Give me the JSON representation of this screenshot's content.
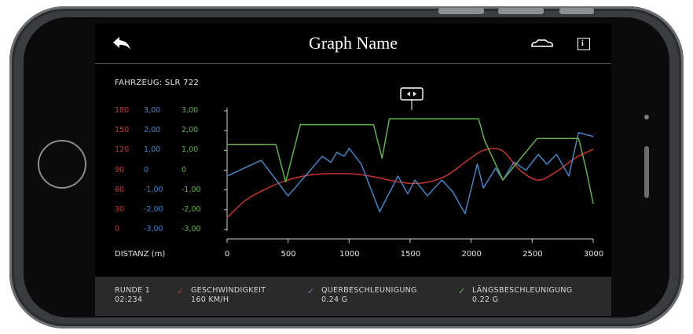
{
  "header": {
    "title": "Graph Name"
  },
  "vehicle_label": "FAHRZEUG: SLR 722",
  "axes": {
    "speed_ticks": [
      "180",
      "150",
      "120",
      "90",
      "60",
      "30",
      "0"
    ],
    "lateral_ticks": [
      "3,00",
      "2,00",
      "1,00",
      "0",
      "-1,00",
      "-2,00",
      "-3,00"
    ],
    "longitudinal_ticks": [
      "3,00",
      "2,00",
      "1,00",
      "0",
      "-1,00",
      "-2,00",
      "-3,00"
    ],
    "x_label": "DISTANZ (m)",
    "x_ticks": [
      "0",
      "500",
      "1000",
      "1500",
      "2000",
      "2500",
      "3000"
    ]
  },
  "colors": {
    "speed": "#c8322c",
    "lateral": "#3f86c7",
    "longitudinal": "#5fb24a"
  },
  "chart_data": {
    "type": "line",
    "xlim": [
      0,
      3000
    ],
    "xlabel": "DISTANZ (m)",
    "series": [
      {
        "name": "GESCHWINDIGKEIT",
        "axis": "speed",
        "ylim": [
          0,
          180
        ],
        "x": [
          0,
          150,
          300,
          450,
          600,
          750,
          900,
          1050,
          1200,
          1350,
          1500,
          1650,
          1800,
          1950,
          2100,
          2250,
          2400,
          2550,
          2700,
          2850,
          3000
        ],
        "y": [
          18,
          44,
          60,
          72,
          80,
          84,
          85,
          84,
          80,
          74,
          70,
          72,
          82,
          102,
          120,
          120,
          90,
          75,
          88,
          108,
          122
        ]
      },
      {
        "name": "QUERBESCHLEUNIGUNG",
        "axis": "lateral",
        "ylim": [
          -3,
          3
        ],
        "x": [
          0,
          280,
          500,
          780,
          850,
          900,
          960,
          1000,
          1100,
          1250,
          1400,
          1480,
          1540,
          1640,
          1760,
          1850,
          1950,
          2050,
          2100,
          2200,
          2260,
          2350,
          2450,
          2550,
          2620,
          2700,
          2800,
          2880,
          3000
        ],
        "y": [
          -0.3,
          0.5,
          -1.3,
          0.7,
          0.4,
          0.9,
          0.7,
          1.1,
          0.3,
          -2.1,
          -0.3,
          -1.2,
          -0.5,
          -1.3,
          -0.5,
          -1.1,
          -2.2,
          0.3,
          -0.9,
          0.1,
          -0.5,
          0.4,
          0.0,
          0.8,
          0.3,
          0.8,
          -0.3,
          1.9,
          1.7
        ]
      },
      {
        "name": "LÄNGSBESCHLEUNIGUNG",
        "axis": "longitudinal",
        "ylim": [
          -3,
          3
        ],
        "x": [
          0,
          400,
          480,
          600,
          1200,
          1270,
          1330,
          2060,
          2110,
          2260,
          2540,
          2560,
          2880,
          2940,
          3000
        ],
        "y": [
          1.3,
          1.3,
          -0.6,
          2.3,
          2.3,
          0.6,
          2.6,
          2.6,
          1.5,
          -0.5,
          1.6,
          1.6,
          1.6,
          0.1,
          -1.7
        ]
      }
    ]
  },
  "footer": {
    "lap": "RUNDE 1",
    "lap_time": "02:234",
    "speed_label": "GESCHWINDIGKEIT",
    "speed_value": "160 KM/H",
    "lateral_label": "QUERBESCHLEUNIGUNG",
    "lateral_value": "0.24 G",
    "longitudinal_label": "LÄNGSBESCHLEUNIGUNG",
    "longitudinal_value": "0.22 G"
  }
}
